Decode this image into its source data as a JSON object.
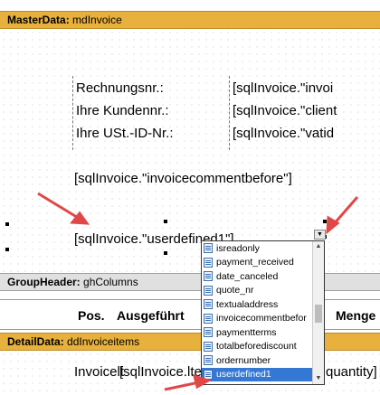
{
  "bands": {
    "master": {
      "type": "MasterData:",
      "name": "mdInvoice"
    },
    "group": {
      "type": "GroupHeader:",
      "name": "ghColumns"
    },
    "detail": {
      "type": "DetailData:",
      "name": "ddInvoiceitems"
    }
  },
  "labels": {
    "rechnungsnr": "Rechnungsnr.:",
    "kundennr": "Ihre Kundennr.:",
    "ustid": "Ihre USt.-ID-Nr.:",
    "invoi": "[sqlInvoice.\"invoi",
    "client": "[sqlInvoice.\"client",
    "vatid": "[sqlInvoice.\"vatid",
    "commentbefore": "[sqlInvoice.\"invoicecommentbefore\"]",
    "userdefined": "[sqlInvoice.\"userdefined1\"]"
  },
  "columns": {
    "pos": "Pos.",
    "ausgefuehrt": "Ausgeführt",
    "menge": "Menge"
  },
  "detail_row": {
    "left": "Invoicelt",
    "overlap": "[sqlInvoice.lte",
    "right": "quantity]"
  },
  "dropdown": {
    "items": [
      "isreadonly",
      "payment_received",
      "date_canceled",
      "quote_nr",
      "textualaddress",
      "invoicecommentbefor",
      "paymentterms",
      "totalbeforediscount",
      "ordernumber",
      "userdefined1"
    ],
    "selected": "userdefined1"
  },
  "colors": {
    "band": "#e8b03c",
    "selection": "#3478d4",
    "arrow": "#e04848"
  }
}
